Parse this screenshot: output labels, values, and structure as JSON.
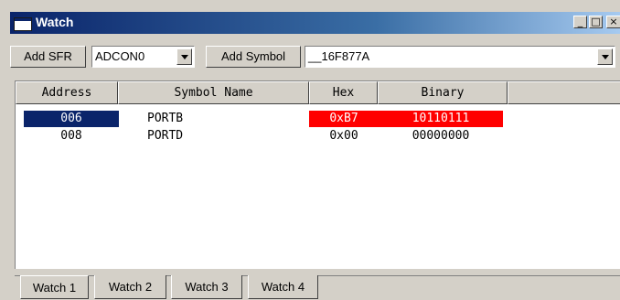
{
  "window": {
    "title": "Watch"
  },
  "titlebar_buttons": {
    "minimize": "_",
    "maximize": "□",
    "close": "×"
  },
  "toolbar": {
    "add_sfr_label": "Add SFR",
    "sfr_select_value": "ADCON0",
    "add_symbol_label": "Add Symbol",
    "symbol_select_value": "__16F877A"
  },
  "columns": [
    "Address",
    "Symbol Name",
    "Hex",
    "Binary"
  ],
  "rows": [
    {
      "address": "006",
      "symbol": "PORTB",
      "hex": "0xB7",
      "binary": "10110111",
      "selected": true,
      "changed": true
    },
    {
      "address": "008",
      "symbol": "PORTD",
      "hex": "0x00",
      "binary": "00000000",
      "selected": false,
      "changed": false
    }
  ],
  "tabs": [
    "Watch 1",
    "Watch 2",
    "Watch 3",
    "Watch 4"
  ],
  "active_tab": "Watch 1",
  "colors": {
    "selection": "#0a246a",
    "changed": "#ff0000",
    "title_gradient_start": "#0a246a",
    "title_gradient_end": "#a6caf0"
  }
}
